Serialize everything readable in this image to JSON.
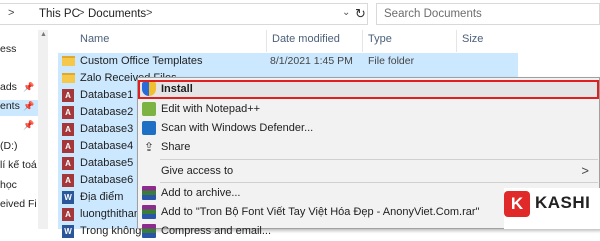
{
  "address": {
    "path": [
      "This PC",
      "Documents"
    ],
    "search_placeholder": "Search Documents"
  },
  "nav": {
    "items": [
      {
        "label": "ess"
      },
      {
        "label": "ads"
      },
      {
        "label": "ents"
      },
      {
        "label": "(D:)"
      },
      {
        "label": "lí kế toá"
      },
      {
        "label": "học"
      },
      {
        "label": "eived Fi"
      }
    ]
  },
  "columns": {
    "name": "Name",
    "date": "Date modified",
    "type": "Type",
    "size": "Size"
  },
  "files": [
    {
      "name": "Custom Office Templates",
      "date": "8/1/2021 1:45 PM",
      "type": "File folder",
      "icon": "folder-icon"
    },
    {
      "name": "Zalo Received Files",
      "date": "",
      "type": "",
      "icon": "folder-icon"
    },
    {
      "name": "Database1",
      "icon": "access-icon"
    },
    {
      "name": "Database2",
      "icon": "access-icon"
    },
    {
      "name": "Database3",
      "icon": "access-icon"
    },
    {
      "name": "Database4",
      "icon": "access-icon"
    },
    {
      "name": "Database5",
      "icon": "access-icon"
    },
    {
      "name": "Database6",
      "icon": "access-icon"
    },
    {
      "name": "Địa điểm",
      "icon": "document-icon"
    },
    {
      "name": "luongthithan",
      "icon": "access-icon"
    },
    {
      "name": "Trong không",
      "icon": "document-icon"
    }
  ],
  "context_menu": {
    "items": [
      {
        "label": "Install",
        "icon": "uac-shield-icon"
      },
      {
        "label": "Edit with Notepad++",
        "icon": "notepad-plus-plus-icon"
      },
      {
        "label": "Scan with Windows Defender...",
        "icon": "windows-defender-icon"
      },
      {
        "label": "Share",
        "icon": "share-icon"
      },
      {
        "label": "Give access to",
        "icon": ""
      },
      {
        "label": "Add to archive...",
        "icon": "winrar-icon"
      },
      {
        "label": "Add to \"Tron Bộ Font Viết Tay Việt Hóa Đẹp - AnonyViet.Com.rar\"",
        "icon": "winrar-icon"
      },
      {
        "label": "Compress and email...",
        "icon": "winrar-icon"
      }
    ]
  },
  "watermark": {
    "badge": "K",
    "text": "KASHI"
  },
  "colors": {
    "selection": "#cce8ff",
    "highlight_border": "#e02020",
    "watermark_red": "#e02a2a"
  }
}
